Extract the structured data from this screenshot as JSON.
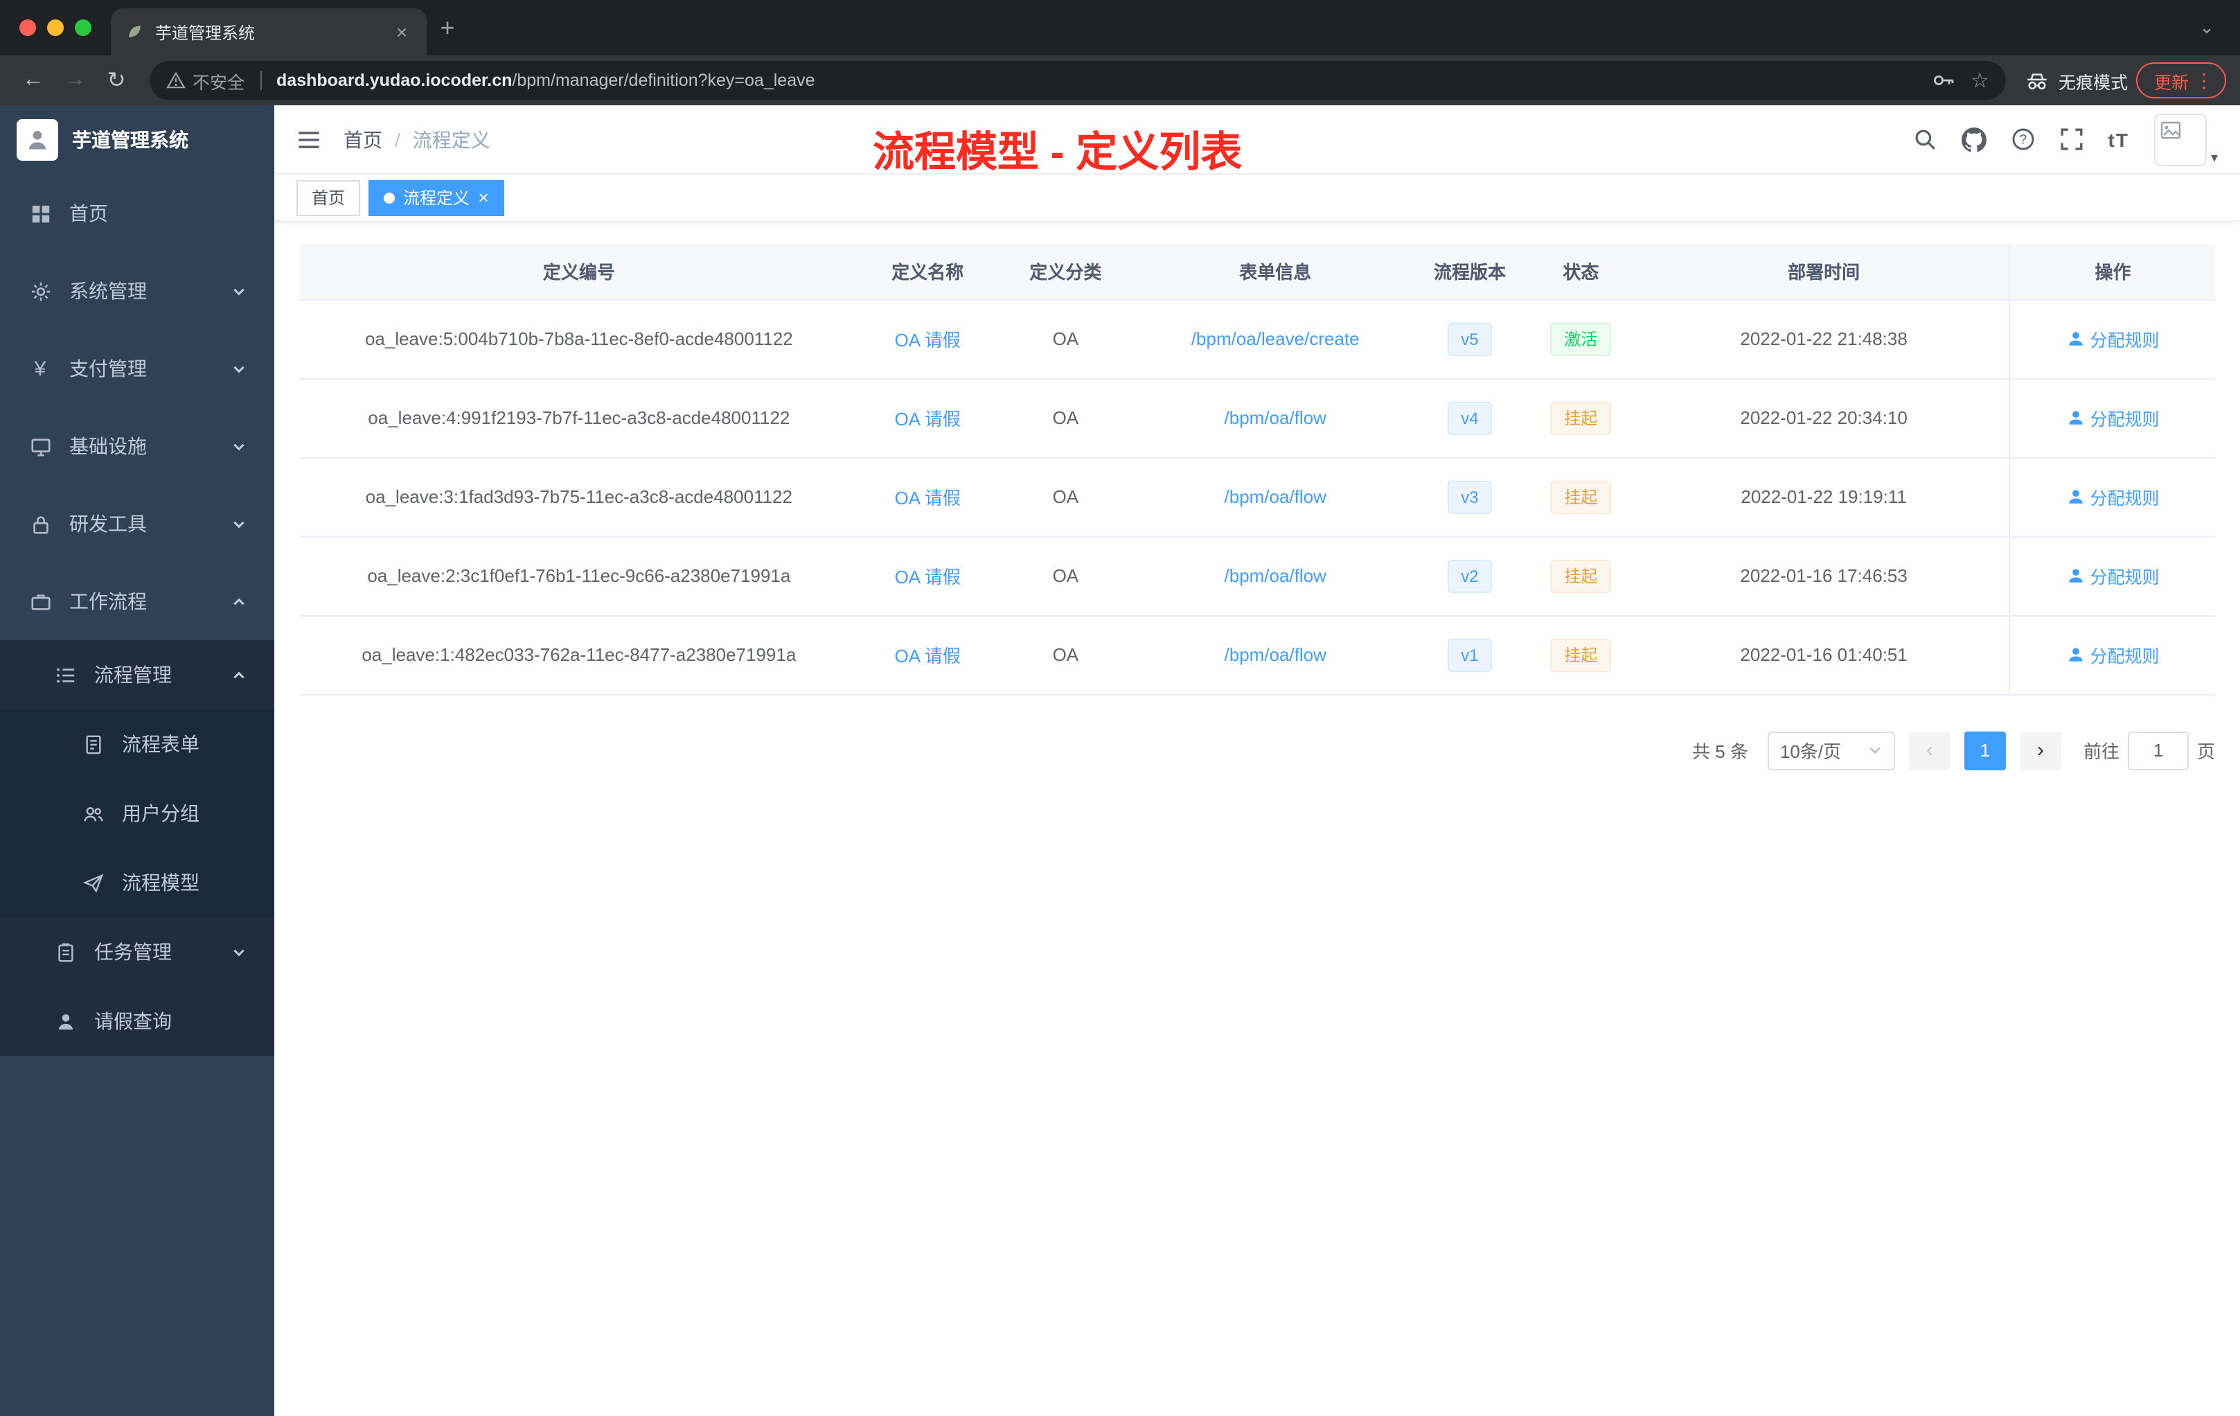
{
  "browser": {
    "tab": {
      "title": "芋道管理系统"
    },
    "toolbar": {
      "security_label": "不安全",
      "url_host": "dashboard.yudao.iocoder.cn",
      "url_path": "/bpm/manager/definition?key=oa_leave",
      "incognito_label": "无痕模式",
      "update_label": "更新"
    }
  },
  "icons": {
    "back": "←",
    "forward": "→",
    "reload": "↻",
    "star": "☆",
    "close": "×",
    "new_tab": "+",
    "more": "⋮",
    "prev": "‹",
    "next": "›",
    "caret_down": "▾",
    "tab_search": "⌄",
    "font_size": "tT",
    "currency": "¥"
  },
  "sidebar": {
    "app_title": "芋道管理系统",
    "items": [
      {
        "label": "首页"
      },
      {
        "label": "系统管理"
      },
      {
        "label": "支付管理"
      },
      {
        "label": "基础设施"
      },
      {
        "label": "研发工具"
      },
      {
        "label": "工作流程"
      },
      {
        "label": "流程管理"
      },
      {
        "label": "流程表单"
      },
      {
        "label": "用户分组"
      },
      {
        "label": "流程模型"
      },
      {
        "label": "任务管理"
      },
      {
        "label": "请假查询"
      }
    ]
  },
  "navbar": {
    "breadcrumb_home": "首页",
    "breadcrumb_separator": "/",
    "breadcrumb_current": "流程定义",
    "annotation": "流程模型 - 定义列表"
  },
  "tags_bar": {
    "tags": [
      {
        "label": "首页",
        "active": false
      },
      {
        "label": "流程定义",
        "active": true
      }
    ]
  },
  "table": {
    "columns": [
      "定义编号",
      "定义名称",
      "定义分类",
      "表单信息",
      "流程版本",
      "状态",
      "部署时间",
      "操作"
    ],
    "action_label": "分配规则",
    "rows": [
      {
        "id": "oa_leave:5:004b710b-7b8a-11ec-8ef0-acde48001122",
        "name": "OA 请假",
        "category": "OA",
        "form": "/bpm/oa/leave/create",
        "version": "v5",
        "status": "激活",
        "status_type": "success",
        "time": "2022-01-22 21:48:38"
      },
      {
        "id": "oa_leave:4:991f2193-7b7f-11ec-a3c8-acde48001122",
        "name": "OA 请假",
        "category": "OA",
        "form": "/bpm/oa/flow",
        "version": "v4",
        "status": "挂起",
        "status_type": "warning",
        "time": "2022-01-22 20:34:10"
      },
      {
        "id": "oa_leave:3:1fad3d93-7b75-11ec-a3c8-acde48001122",
        "name": "OA 请假",
        "category": "OA",
        "form": "/bpm/oa/flow",
        "version": "v3",
        "status": "挂起",
        "status_type": "warning",
        "time": "2022-01-22 19:19:11"
      },
      {
        "id": "oa_leave:2:3c1f0ef1-76b1-11ec-9c66-a2380e71991a",
        "name": "OA 请假",
        "category": "OA",
        "form": "/bpm/oa/flow",
        "version": "v2",
        "status": "挂起",
        "status_type": "warning",
        "time": "2022-01-16 17:46:53"
      },
      {
        "id": "oa_leave:1:482ec033-762a-11ec-8477-a2380e71991a",
        "name": "OA 请假",
        "category": "OA",
        "form": "/bpm/oa/flow",
        "version": "v1",
        "status": "挂起",
        "status_type": "warning",
        "time": "2022-01-16 01:40:51"
      }
    ]
  },
  "pagination": {
    "total_label": "共 5 条",
    "page_size_label": "10条/页",
    "current_page": "1",
    "goto_label": "前往",
    "goto_value": "1",
    "page_unit_label": "页"
  },
  "colors": {
    "accent": "#409eff",
    "status_active": "#13ce66",
    "status_suspended": "#e6a23c",
    "annotation_red": "#fd2b20",
    "sidebar_bg": "#304156",
    "submenu_bg": "#1f2d3d"
  }
}
